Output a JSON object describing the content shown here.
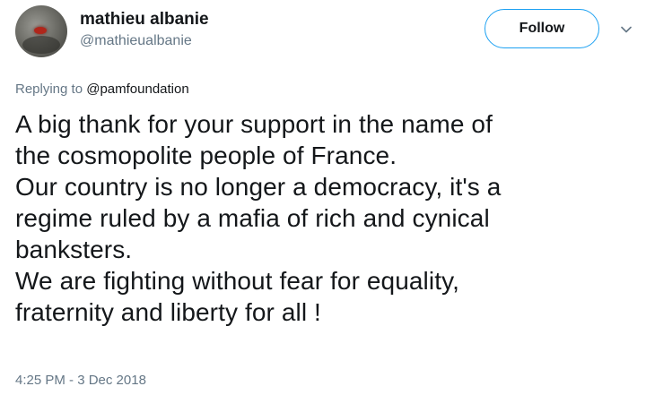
{
  "author": {
    "name": "mathieu albanie",
    "handle": "@mathieualbanie"
  },
  "follow_label": "Follow",
  "reply_context": {
    "prefix": "Replying to",
    "mention": "@pamfoundation"
  },
  "tweet_lines": [
    "A big thank for your support in the name of",
    "the cosmopolite people of France.",
    "Our country is no longer a democracy, it's a",
    "regime ruled by a mafia of rich and cynical",
    "banksters.",
    "We are fighting without fear for equality,",
    "fraternity and liberty for all !"
  ],
  "timestamp": "4:25 PM - 3 Dec 2018",
  "colors": {
    "accent": "#1da1f2",
    "secondary_text": "#657786",
    "primary_text": "#14171a"
  },
  "icons": {
    "menu": "chevron-down-icon"
  }
}
